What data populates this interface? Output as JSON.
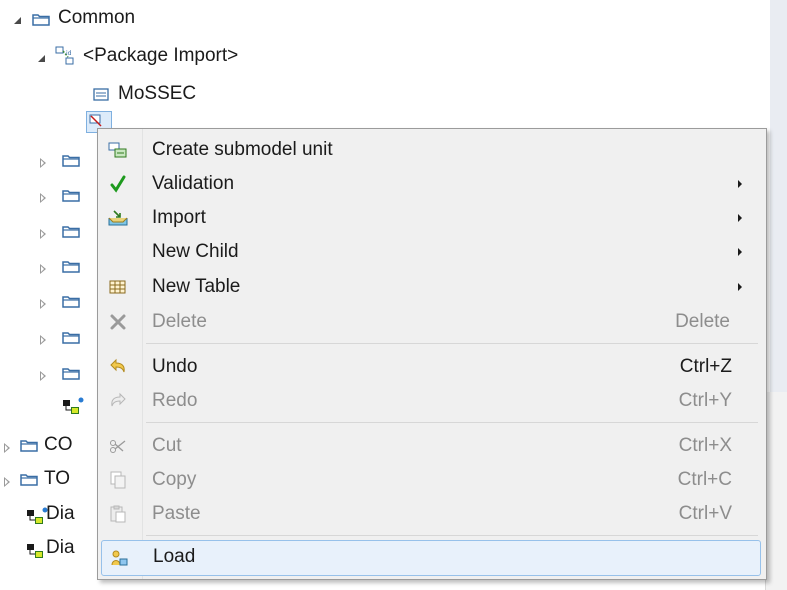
{
  "tree": {
    "root_label": "Common",
    "package_import_label": "<Package Import>",
    "mossec_label": "MoSSEC",
    "partial_items": [
      "CO",
      "TO",
      "Dia",
      "Dia"
    ]
  },
  "context_menu": {
    "items": [
      {
        "label": "Create submodel unit",
        "shortcut": "",
        "submenu": false,
        "enabled": true,
        "icon": "submodel-icon"
      },
      {
        "label": "Validation",
        "shortcut": "",
        "submenu": true,
        "enabled": true,
        "icon": "checkmark-icon"
      },
      {
        "label": "Import",
        "shortcut": "",
        "submenu": true,
        "enabled": true,
        "icon": "import-icon"
      },
      {
        "label": "New Child",
        "shortcut": "",
        "submenu": true,
        "enabled": true,
        "icon": ""
      },
      {
        "label": "New Table",
        "shortcut": "",
        "submenu": true,
        "enabled": true,
        "icon": "table-icon"
      },
      {
        "label": "Delete",
        "shortcut": "Delete",
        "submenu": false,
        "enabled": false,
        "icon": "delete-icon"
      },
      {
        "label": "Undo",
        "shortcut": "Ctrl+Z",
        "submenu": false,
        "enabled": true,
        "icon": "undo-icon"
      },
      {
        "label": "Redo",
        "shortcut": "Ctrl+Y",
        "submenu": false,
        "enabled": false,
        "icon": "redo-icon"
      },
      {
        "label": "Cut",
        "shortcut": "Ctrl+X",
        "submenu": false,
        "enabled": false,
        "icon": "cut-icon"
      },
      {
        "label": "Copy",
        "shortcut": "Ctrl+C",
        "submenu": false,
        "enabled": false,
        "icon": "copy-icon"
      },
      {
        "label": "Paste",
        "shortcut": "Ctrl+V",
        "submenu": false,
        "enabled": false,
        "icon": "paste-icon"
      },
      {
        "label": "Load",
        "shortcut": "",
        "submenu": false,
        "enabled": true,
        "icon": "load-icon"
      }
    ]
  },
  "colors": {
    "folder_stroke": "#3a6ea5",
    "checkmark_green": "#1e9a1e",
    "hover_border": "#97c1ea",
    "hover_fill": "#e8f1fb"
  }
}
